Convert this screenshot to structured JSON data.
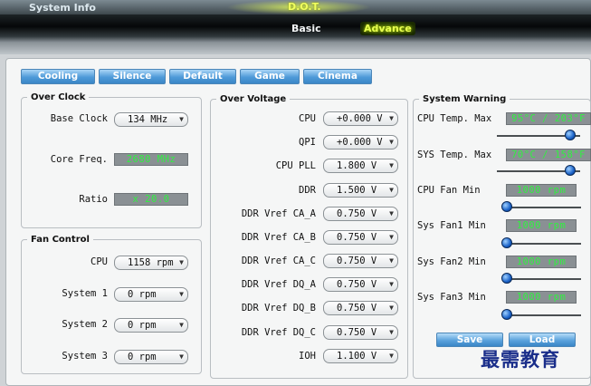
{
  "header": {
    "system_info": "System Info",
    "dot": "D.O.T.",
    "tabs": {
      "basic": "Basic",
      "advance": "Advance"
    }
  },
  "preset_tabs": [
    "Cooling",
    "Silence",
    "Default",
    "Game",
    "Cinema"
  ],
  "over_clock": {
    "title": "Over Clock",
    "base_clock_label": "Base Clock",
    "base_clock_value": "134 MHz",
    "core_freq_label": "Core Freq.",
    "core_freq_value": "2680 MHz",
    "ratio_label": "Ratio",
    "ratio_value": "x 20.0"
  },
  "fan_control": {
    "title": "Fan Control",
    "rows": [
      {
        "label": "CPU",
        "value": "1158 rpm"
      },
      {
        "label": "System 1",
        "value": "0 rpm"
      },
      {
        "label": "System 2",
        "value": "0 rpm"
      },
      {
        "label": "System 3",
        "value": "0 rpm"
      }
    ]
  },
  "over_voltage": {
    "title": "Over Voltage",
    "rows": [
      {
        "label": "CPU",
        "value": "+0.000 V"
      },
      {
        "label": "QPI",
        "value": "+0.000 V"
      },
      {
        "label": "CPU PLL",
        "value": "1.800 V"
      },
      {
        "label": "DDR",
        "value": "1.500 V"
      },
      {
        "label": "DDR Vref CA_A",
        "value": "0.750 V"
      },
      {
        "label": "DDR Vref CA_B",
        "value": "0.750 V"
      },
      {
        "label": "DDR Vref CA_C",
        "value": "0.750 V"
      },
      {
        "label": "DDR Vref DQ_A",
        "value": "0.750 V"
      },
      {
        "label": "DDR Vref DQ_B",
        "value": "0.750 V"
      },
      {
        "label": "DDR Vref DQ_C",
        "value": "0.750 V"
      },
      {
        "label": "IOH",
        "value": "1.100 V"
      }
    ]
  },
  "system_warning": {
    "title": "System Warning",
    "rows": [
      {
        "label": "CPU Temp. Max",
        "value": "95°C / 203°F",
        "level": 0.88
      },
      {
        "label": "SYS Temp. Max",
        "value": "70°C / 158°F",
        "level": 0.88
      },
      {
        "label": "CPU Fan Min",
        "value": "1000 rpm",
        "level": 0.02
      },
      {
        "label": "Sys Fan1 Min",
        "value": "1000 rpm",
        "level": 0.02
      },
      {
        "label": "Sys Fan2 Min",
        "value": "1000 rpm",
        "level": 0.02
      },
      {
        "label": "Sys Fan3 Min",
        "value": "1000 rpm",
        "level": 0.02
      }
    ],
    "save_label": "Save",
    "load_label": "Load"
  },
  "watermark": "最需教育",
  "colors": {
    "display_text": "#30f040",
    "tab_blue": "#4e9ad8",
    "advance_highlight": "#e7ff50"
  }
}
